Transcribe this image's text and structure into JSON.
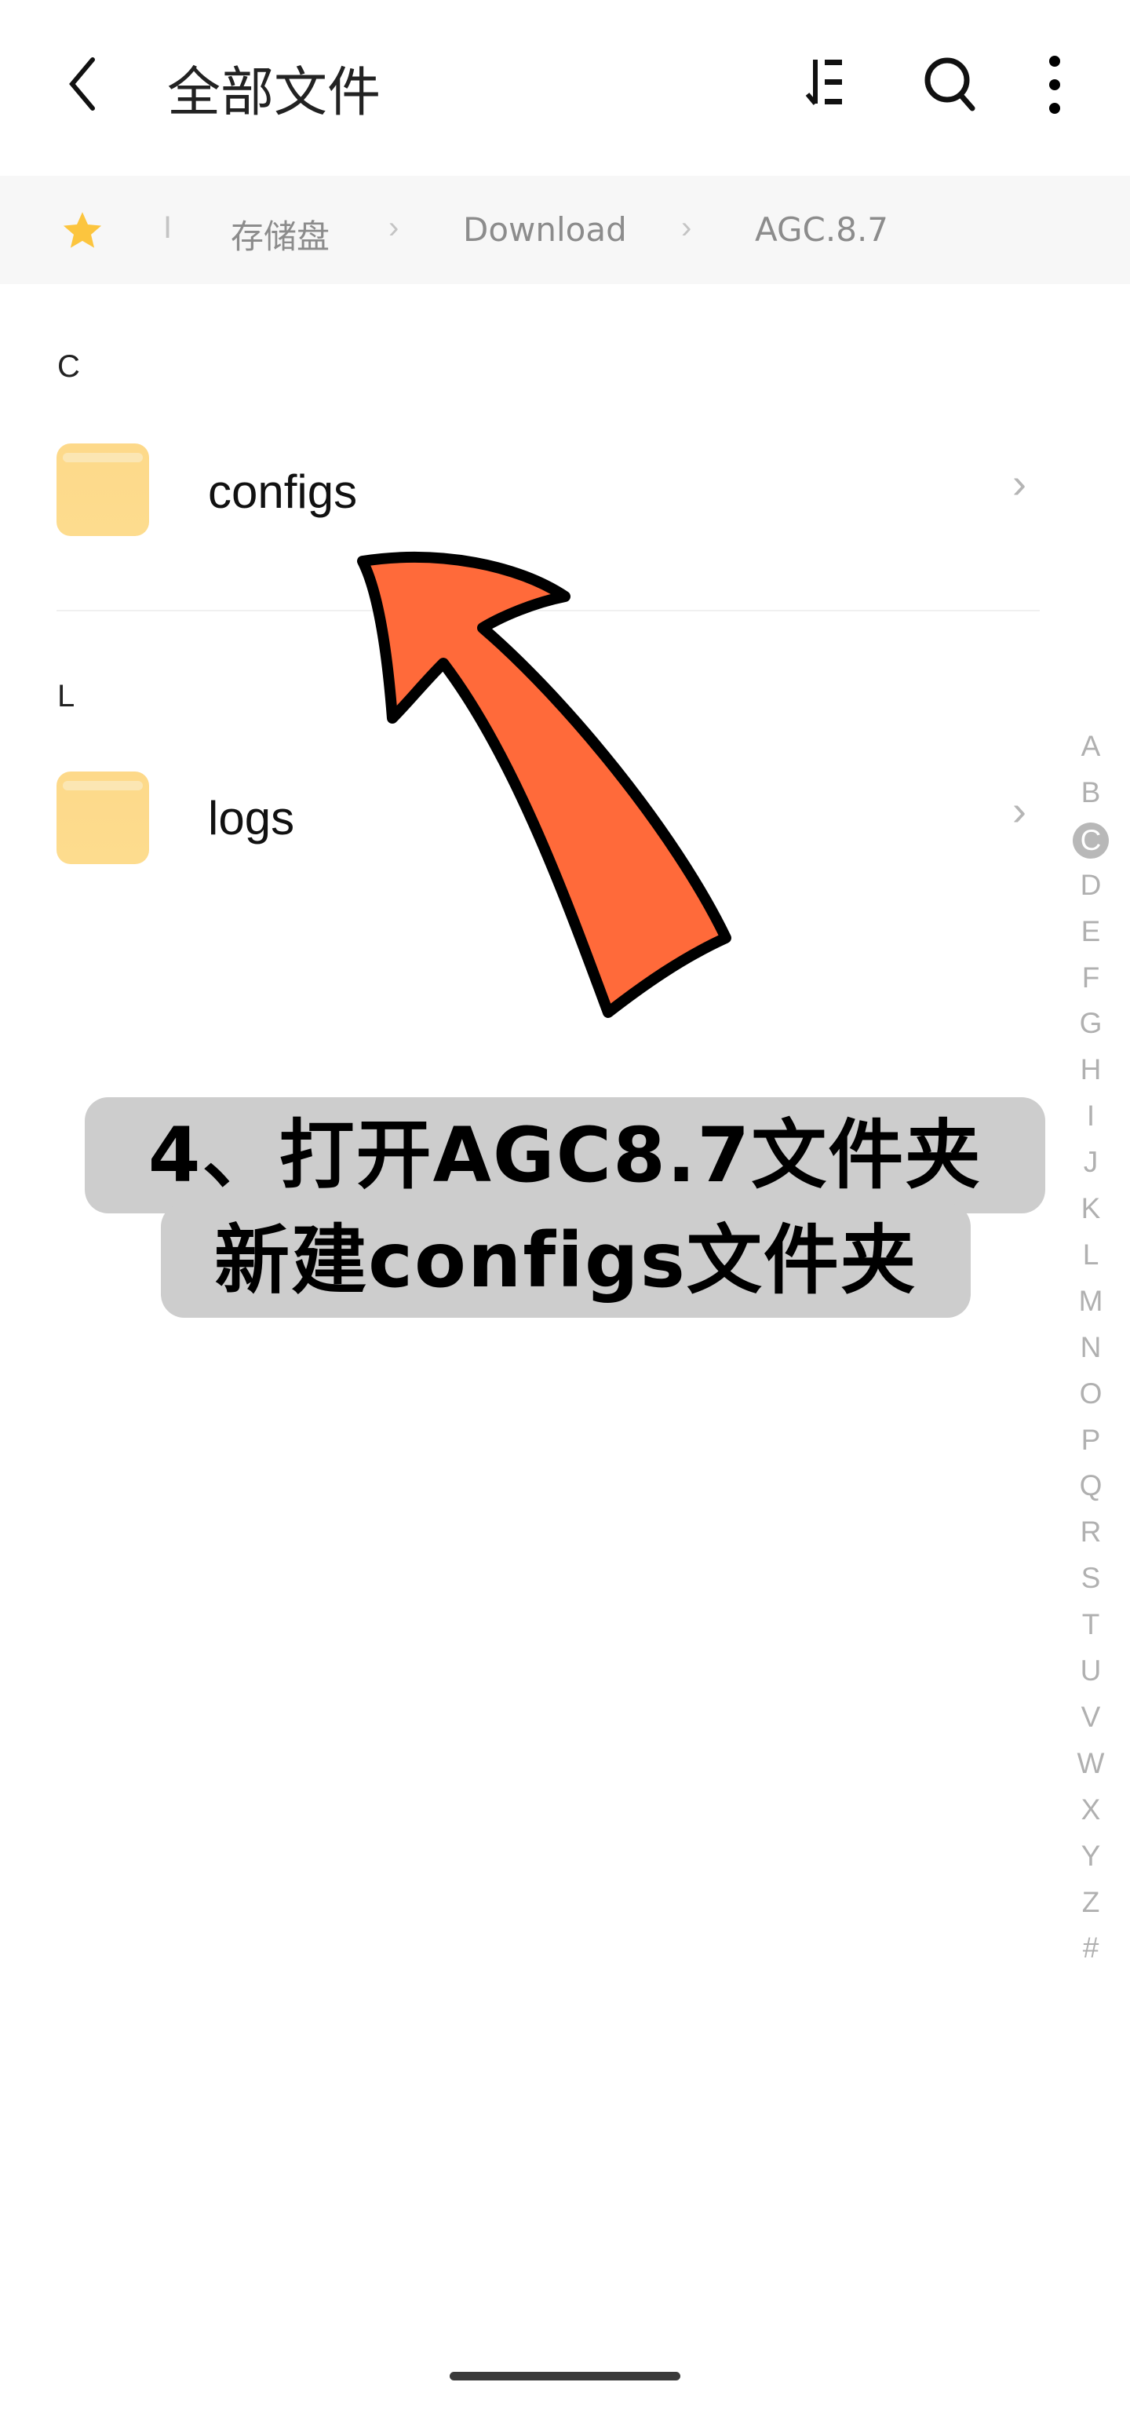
{
  "header": {
    "title": "全部文件",
    "icons": [
      "back-icon",
      "sort-icon",
      "search-icon",
      "more-icon"
    ]
  },
  "breadcrumb": {
    "items": [
      "存储盘",
      "Download",
      "AGC.8.7"
    ],
    "separator": "I"
  },
  "sections": [
    {
      "letter": "C",
      "items": [
        {
          "name": "configs"
        }
      ]
    },
    {
      "letter": "L",
      "items": [
        {
          "name": "logs"
        }
      ]
    }
  ],
  "index": [
    "A",
    "B",
    "C",
    "D",
    "E",
    "F",
    "G",
    "H",
    "I",
    "J",
    "K",
    "L",
    "M",
    "N",
    "O",
    "P",
    "Q",
    "R",
    "S",
    "T",
    "U",
    "V",
    "W",
    "X",
    "Y",
    "Z",
    "#"
  ],
  "index_active": "C",
  "caption": {
    "line1": "4、打开AGC8.7文件夹",
    "line2": "新建configs文件夹"
  },
  "colors": {
    "arrow": "#ff6a3a",
    "star": "#fcc53e",
    "folder": "#fdd98a"
  }
}
